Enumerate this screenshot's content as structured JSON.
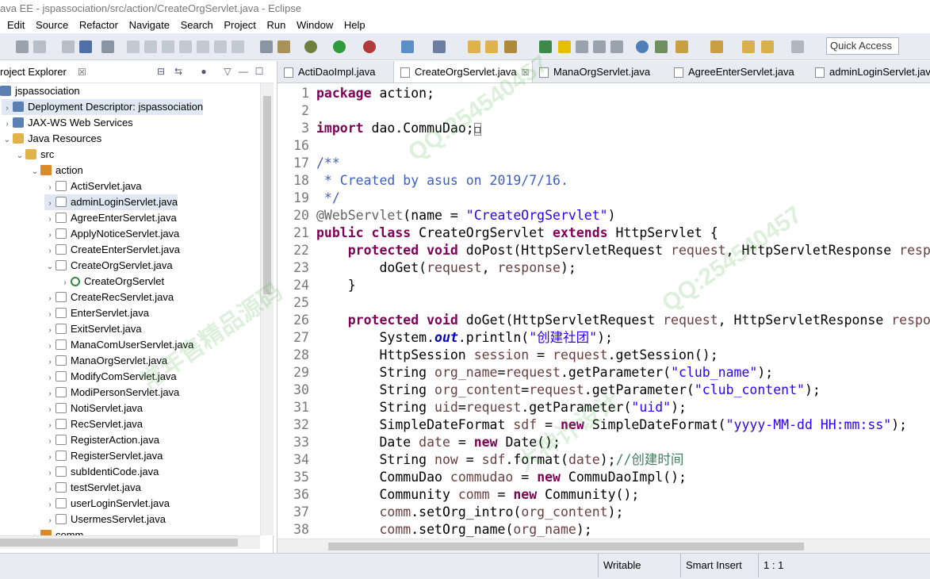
{
  "window": {
    "title": "ava EE - jspassociation/src/action/CreateOrgServlet.java - Eclipse"
  },
  "menu": [
    "Edit",
    "Source",
    "Refactor",
    "Navigate",
    "Search",
    "Project",
    "Run",
    "Window",
    "Help"
  ],
  "quick_access": "Quick Access",
  "explorer": {
    "title": "roject Explorer",
    "close": "☒",
    "items": [
      {
        "label": "jspassociation",
        "icon": "project-icon"
      },
      {
        "label": "Deployment Descriptor: jspassociation",
        "icon": "descriptor-icon"
      },
      {
        "label": "JAX-WS Web Services",
        "icon": "webservice-icon"
      },
      {
        "label": "Java Resources",
        "icon": "java-resources-icon"
      },
      {
        "label": "src",
        "icon": "folder-icon"
      },
      {
        "label": "action",
        "icon": "package-icon"
      },
      {
        "label": "ActiServlet.java"
      },
      {
        "label": "adminLoginServlet.java"
      },
      {
        "label": "AgreeEnterServlet.java"
      },
      {
        "label": "ApplyNoticeServlet.java"
      },
      {
        "label": "CreateEnterServlet.java"
      },
      {
        "label": "CreateOrgServlet.java"
      },
      {
        "label": "CreateOrgServlet",
        "icon": "class-icon"
      },
      {
        "label": "CreateRecServlet.java"
      },
      {
        "label": "EnterServlet.java"
      },
      {
        "label": "ExitServlet.java"
      },
      {
        "label": "ManaComUserServlet.java"
      },
      {
        "label": "ManaOrgServlet.java"
      },
      {
        "label": "ModifyComServlet.java"
      },
      {
        "label": "ModiPersonServlet.java"
      },
      {
        "label": "NotiServlet.java"
      },
      {
        "label": "RecServlet.java"
      },
      {
        "label": "RegisterAction.java"
      },
      {
        "label": "RegisterServlet.java"
      },
      {
        "label": "subIdentiCode.java"
      },
      {
        "label": "testServlet.java"
      },
      {
        "label": "userLoginServlet.java"
      },
      {
        "label": "UsermesServlet.java"
      },
      {
        "label": "comm",
        "icon": "package-icon"
      }
    ]
  },
  "editor_tabs": [
    {
      "label": "ActiDaoImpl.java"
    },
    {
      "label": "CreateOrgServlet.java",
      "close": "☒"
    },
    {
      "label": "ManaOrgServlet.java"
    },
    {
      "label": "AgreeEnterServlet.java"
    },
    {
      "label": "adminLoginServlet.java"
    }
  ],
  "code_lines": [
    {
      "n": "1",
      "html": "<span class=\"kw\">package</span> action;"
    },
    {
      "n": "2",
      "html": ""
    },
    {
      "n": "3",
      "html": "<span class=\"kw\">import</span> dao.CommuDao;<span style=\"border:1px solid #888;font-size:12px\">□</span>"
    },
    {
      "n": "16",
      "html": ""
    },
    {
      "n": "17",
      "html": "<span class=\"cmt\">/**</span>"
    },
    {
      "n": "18",
      "html": "<span class=\"cmt\"> * Created by asus on 2019/7/16.</span>"
    },
    {
      "n": "19",
      "html": "<span class=\"cmt\"> */</span>"
    },
    {
      "n": "20",
      "html": "<span class=\"ann\">@WebServlet</span>(name = <span class=\"str\">\"CreateOrgServlet\"</span>)"
    },
    {
      "n": "21",
      "html": "<span class=\"kw\">public class</span> CreateOrgServlet <span class=\"kw\">extends</span> HttpServlet {"
    },
    {
      "n": "22",
      "html": "    <span class=\"kw\">protected void</span> doPost(HttpServletRequest <span class=\"var\">request</span>, HttpServletResponse <span class=\"var\">response</span>) <span class=\"kw\">throws</span>"
    },
    {
      "n": "23",
      "html": "        doGet(<span class=\"var\">request</span>, <span class=\"var\">response</span>);"
    },
    {
      "n": "24",
      "html": "    }"
    },
    {
      "n": "25",
      "html": ""
    },
    {
      "n": "26",
      "html": "    <span class=\"kw\">protected void</span> doGet(HttpServletRequest <span class=\"var\">request</span>, HttpServletResponse <span class=\"var\">response</span>) <span class=\"kw\">throws</span>"
    },
    {
      "n": "27",
      "html": "        System.<span class=\"fld\">out</span>.println(<span class=\"str\">\"创建社团\"</span>);"
    },
    {
      "n": "28",
      "html": "        HttpSession <span class=\"var\">session</span> = <span class=\"var\">request</span>.getSession();"
    },
    {
      "n": "29",
      "html": "        String <span class=\"var\">org_name</span>=<span class=\"var\">request</span>.getParameter(<span class=\"str\">\"club_name\"</span>);"
    },
    {
      "n": "30",
      "html": "        String <span class=\"var\">org_content</span>=<span class=\"var\">request</span>.getParameter(<span class=\"str\">\"club_content\"</span>);"
    },
    {
      "n": "31",
      "html": "        String <span class=\"var\">uid</span>=<span class=\"var\">request</span>.getParameter(<span class=\"str\">\"uid\"</span>);"
    },
    {
      "n": "32",
      "html": "        SimpleDateFormat <span class=\"var\">sdf</span> = <span class=\"kw\">new</span> SimpleDateFormat(<span class=\"str\">\"yyyy-MM-dd HH:mm:ss\"</span>);"
    },
    {
      "n": "33",
      "html": "        Date <span class=\"var\">date</span> = <span class=\"kw\">new</span> Date();"
    },
    {
      "n": "34",
      "html": "        String <span class=\"var\">now</span> = <span class=\"var\">sdf</span>.format(<span class=\"var\">date</span>);<span class=\"lc\">//创建时间</span>"
    },
    {
      "n": "35",
      "html": "        CommuDao <span class=\"var\">commudao</span> = <span class=\"kw\">new</span> CommuDaoImpl();"
    },
    {
      "n": "36",
      "html": "        Community <span class=\"var\">comm</span> = <span class=\"kw\">new</span> Community();"
    },
    {
      "n": "37",
      "html": "        <span class=\"var\">comm</span>.setOrg_intro(<span class=\"var\">org_content</span>);"
    },
    {
      "n": "38",
      "html": "        <span class=\"var\">comm</span>.setOrg_name(<span class=\"var\">org_name</span>);"
    }
  ],
  "status": {
    "writable": "Writable",
    "insert": "Smart Insert",
    "position": "1 : 1"
  },
  "watermark": [
    "QQ:254540457",
    "常年售精品源码",
    "大神计设计"
  ]
}
